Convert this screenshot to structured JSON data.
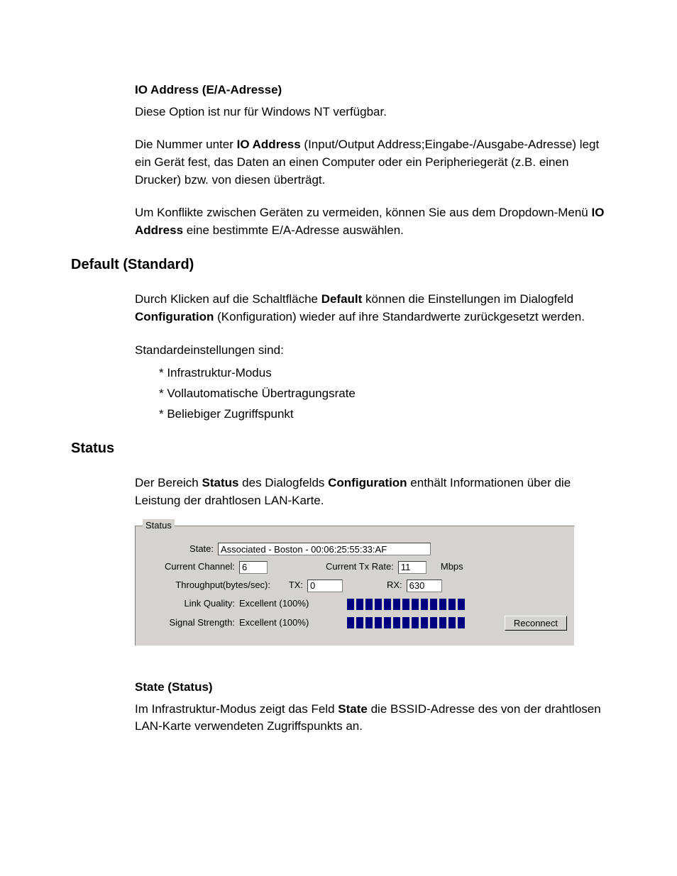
{
  "io_address": {
    "title": "IO Address (E/A-Adresse)",
    "p1": "Diese Option ist nur für Windows NT verfügbar.",
    "p2_pre": "Die Nummer unter ",
    "p2_bold": "IO Address",
    "p2_post": " (Input/Output Address;Eingabe-/Ausgabe-Adresse) legt ein Gerät fest, das Daten an einen Computer oder ein Peripheriegerät (z.B. einen Drucker) bzw. von diesen überträgt.",
    "p3_pre": "Um Konflikte zwischen Geräten zu vermeiden, können Sie aus dem Dropdown-Menü ",
    "p3_bold": "IO Address",
    "p3_post": " eine bestimmte E/A-Adresse auswählen."
  },
  "default_section": {
    "heading": "Default (Standard)",
    "p1_pre": "Durch Klicken auf die Schaltfläche ",
    "p1_b1": "Default",
    "p1_mid": " können die Einstellungen im Dialogfeld ",
    "p1_b2": "Configuration",
    "p1_post": " (Konfiguration) wieder auf ihre Standardwerte zurückgesetzt werden.",
    "p2": "Standardeinstellungen sind:",
    "bullets": {
      "b1": "* Infrastruktur-Modus",
      "b2": "* Vollautomatische Übertragungsrate",
      "b3": "* Beliebiger Zugriffspunkt"
    }
  },
  "status_section": {
    "heading": "Status",
    "p1_pre": "Der Bereich ",
    "p1_b1": "Status",
    "p1_mid": " des Dialogfelds ",
    "p1_b2": "Configuration",
    "p1_post": " enthält Informationen über die Leistung der drahtlosen LAN-Karte."
  },
  "status_box": {
    "legend": "Status",
    "state_label": "State:",
    "state_value": "Associated - Boston - 00:06:25:55:33:AF",
    "current_channel_label": "Current Channel:",
    "current_channel_value": "6",
    "current_tx_rate_label": "Current Tx Rate:",
    "current_tx_rate_value": "11",
    "mbps": "Mbps",
    "throughput_label": "Throughput(bytes/sec):",
    "tx_label": "TX:",
    "tx_value": "0",
    "rx_label": "RX:",
    "rx_value": "630",
    "link_quality_label": "Link Quality:",
    "link_quality_value": "Excellent (100%)",
    "signal_strength_label": "Signal Strength:",
    "signal_strength_value": "Excellent (100%)",
    "reconnect": "Reconnect"
  },
  "state_desc": {
    "title": "State (Status)",
    "p1_pre": "Im Infrastruktur-Modus zeigt das Feld ",
    "p1_bold": "State",
    "p1_post": " die BSSID-Adresse des von der drahtlosen LAN-Karte verwendeten Zugriffspunkts an."
  }
}
